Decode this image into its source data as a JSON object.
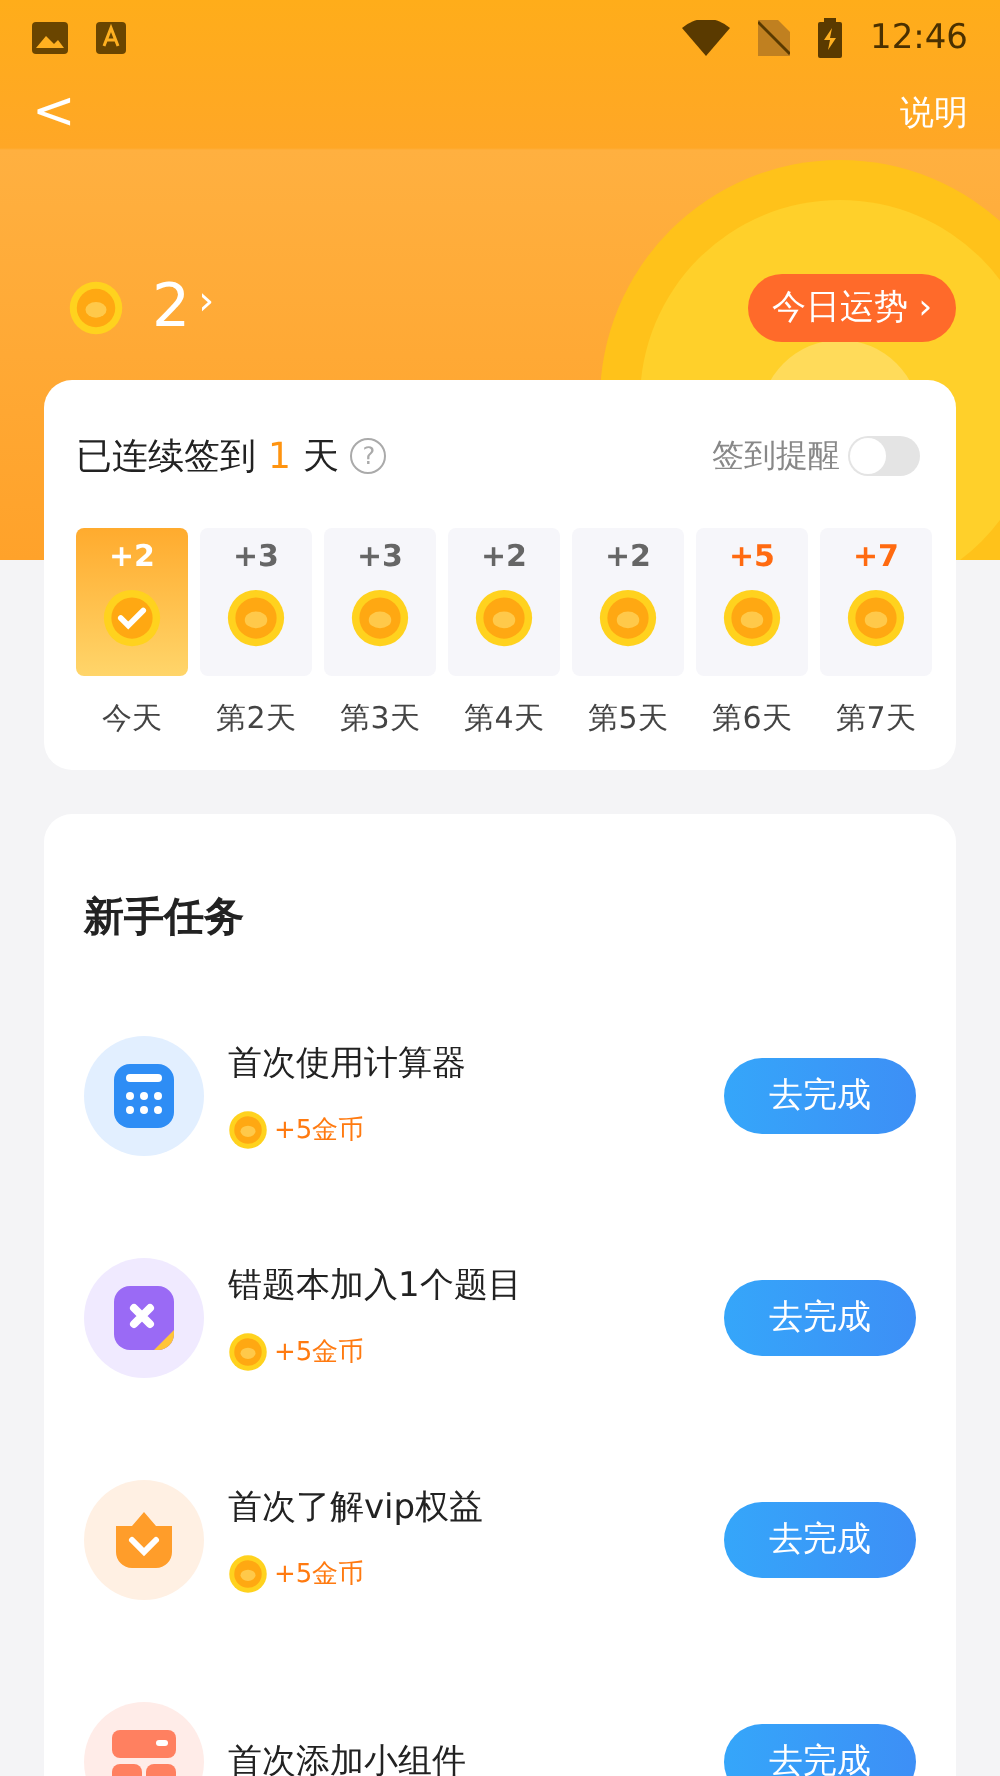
{
  "status_bar": {
    "time": "12:46"
  },
  "nav": {
    "back": "<",
    "action": "说明"
  },
  "balance": {
    "amount": "2",
    "chevron": "›",
    "fortune_button": "今日运势 ›"
  },
  "checkin": {
    "prefix": "已连续签到",
    "count": "1",
    "suffix": "天",
    "help": "?",
    "reminder_label": "签到提醒",
    "reminder_on": false,
    "days": [
      {
        "amount": "+2",
        "label": "今天",
        "selected": true,
        "highlight": false
      },
      {
        "amount": "+3",
        "label": "第2天",
        "selected": false,
        "highlight": false
      },
      {
        "amount": "+3",
        "label": "第3天",
        "selected": false,
        "highlight": false
      },
      {
        "amount": "+2",
        "label": "第4天",
        "selected": false,
        "highlight": false
      },
      {
        "amount": "+2",
        "label": "第5天",
        "selected": false,
        "highlight": false
      },
      {
        "amount": "+5",
        "label": "第6天",
        "selected": false,
        "highlight": true
      },
      {
        "amount": "+7",
        "label": "第7天",
        "selected": false,
        "highlight": true
      }
    ]
  },
  "tasks": {
    "title": "新手任务",
    "items": [
      {
        "kind": "calculator",
        "title": "首次使用计算器",
        "reward": "+5金币",
        "button": "去完成"
      },
      {
        "kind": "mistakes",
        "title": "错题本加入1个题目",
        "reward": "+5金币",
        "button": "去完成"
      },
      {
        "kind": "vip",
        "title": "首次了解vip权益",
        "reward": "+5金币",
        "button": "去完成"
      },
      {
        "kind": "widget",
        "title": "首次添加小组件",
        "button": "去完成"
      }
    ]
  }
}
